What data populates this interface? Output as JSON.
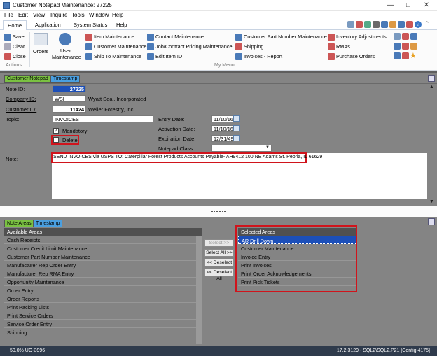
{
  "window": {
    "title": "Customer Notepad Maintenance: 27225"
  },
  "menu": [
    "File",
    "Edit",
    "View",
    "Inquire",
    "Tools",
    "Window",
    "Help"
  ],
  "ribbon_tabs": [
    "Home",
    "Application",
    "System Status",
    "Help"
  ],
  "actions": {
    "save": "Save",
    "clear": "Clear",
    "close": "Close",
    "group_label": "Actions"
  },
  "big_buttons": {
    "orders": "Orders",
    "user_maint_1": "User",
    "user_maint_2": "Maintenance"
  },
  "menu_links": {
    "col1": [
      "Item Maintenance",
      "Customer Maintenance",
      "Ship To Maintenance"
    ],
    "col2": [
      "Contact Maintenance",
      "Job/Contract Pricing Maintenance",
      "Edit Item ID"
    ],
    "col3": [
      "Customer Part Number Maintenance",
      "Shipping",
      "Invoices - Report"
    ],
    "col4": [
      "Inventory Adjustments",
      "RMAs",
      "Purchase Orders"
    ],
    "group_label": "My Menu"
  },
  "tabs_top": [
    "Customer Notepad",
    "Timestamp"
  ],
  "form": {
    "note_id_label": "Note ID:",
    "note_id": "27225",
    "company_id_label": "Company ID:",
    "company_id": "WSI",
    "company_name": "Wyatt Seal, Incorporated",
    "customer_id_label": "Customer ID:",
    "customer_id": "11424",
    "customer_name": "Weiler Forestry, Inc",
    "topic_label": "Topic:",
    "topic": "INVOICES",
    "mandatory_label": "Mandatory",
    "delete_label": "Delete",
    "entry_date_label": "Entry Date:",
    "entry_date": "11/10/16",
    "activation_date_label": "Activation Date:",
    "activation_date": "11/10/16",
    "expiration_date_label": "Expiration Date:",
    "expiration_date": "12/31/49",
    "notepad_class_label": "Notepad Class:",
    "note_label": "Note:",
    "note": "SEND INVOICES via USPS TO: Caterpillar Forest Products Accounts Payable- AH9412 100 NE Adams St. Peoria, IL 61629"
  },
  "tabs_bottom": [
    "Note Areas",
    "Timestamp"
  ],
  "available": {
    "header": "Available Areas",
    "items": [
      "Cash Receipts",
      "Customer Credit Limit Maintenance",
      "Customer Part Number Maintenance",
      "Manufacturer Rep Order Entry",
      "Manufacturer Rep RMA Entry",
      "Opportunity Maintenance",
      "Order Entry",
      "Order Reports",
      "Print Packing Lists",
      "Print Service Orders",
      "Service Order Entry",
      "Shipping"
    ]
  },
  "transfer": {
    "select": "Select >>",
    "select_all": "Select All >>",
    "deselect": "<< Deselect",
    "deselect_all": "<< Deselect All"
  },
  "selected": {
    "header": "Selected Areas",
    "items": [
      "AR Drill Down",
      "Customer Maintenance",
      "Invoice Entry",
      "Print Invoices",
      "Print Order Acknowledgements",
      "Print Pick Tickets"
    ]
  },
  "status": {
    "left": "50.0% UO-3996",
    "right": "17.2.3129 - SQL2\\SQL2.P21 [Config 4175]"
  }
}
